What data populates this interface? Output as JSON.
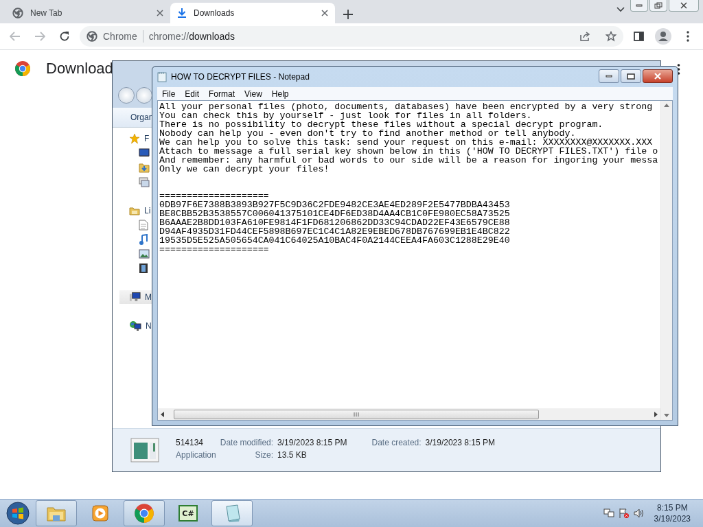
{
  "browser": {
    "tabs": [
      {
        "kind": "newtab",
        "title": "New Tab",
        "selected": false
      },
      {
        "kind": "downloads",
        "title": "Downloads",
        "selected": true
      }
    ],
    "omnibox": {
      "site_label": "Chrome",
      "url_scheme": "chrome://",
      "url_path": "downloads"
    },
    "page_title": "Download"
  },
  "explorer": {
    "toolbar_label": "Organ",
    "nav_groups": [
      {
        "label": "F",
        "kind": "favorites"
      },
      {
        "label": "Li",
        "kind": "libraries"
      },
      {
        "label": "M",
        "kind": "computer",
        "selected": true
      },
      {
        "label": "N",
        "kind": "network",
        "selected": false
      }
    ],
    "details": {
      "name": "514134",
      "type": "Application",
      "fields": [
        {
          "label": "Date modified:",
          "value": "3/19/2023 8:15 PM"
        },
        {
          "label": "Date created:",
          "value": "3/19/2023 8:15 PM"
        },
        {
          "label": "Size:",
          "value": "13.5 KB"
        }
      ]
    }
  },
  "notepad": {
    "title": "HOW TO DECRYPT FILES - Notepad",
    "menu": [
      "File",
      "Edit",
      "Format",
      "View",
      "Help"
    ],
    "message": [
      "All your personal files (photo, documents, databases) have been encrypted by a very strong",
      "You can check this by yourself - just look for files in all folders.",
      "There is no possibility to decrypt these files without a special decrypt program.",
      "Nobody can help you - even don't try to find another method or tell anybody.",
      "We can help you to solve this task: send your request on this e-mail: XXXXXXXX@XXXXXXX.XXX",
      "Attach to message a full serial key shown below in this ('HOW TO DECRYPT FILES.TXT') file o",
      "And remember: any harmful or bad words to our side will be a reason for ingoring your messa",
      "Only we can decrypt your files!"
    ],
    "key_block": [
      "====================",
      "0DB97F6E7388B3893B927F5C9D36C2FDE9482CE3AE4ED289F2E5477BDBA43453",
      "BE8CBB52B3538557C006041375101CE4DF6ED38D4AA4CB1C0FE980EC58A73525",
      "B6AAAE2B8DD103FA610FE9814F1FD681206862DD33C94CDAD22EF43E6579CE88",
      "D94AF4935D31FD44CEF5898B697EC1C4C1A82E9EBED678DB767699EB1E4BC822",
      "19535D5E525A505654CA041C64025A10BAC4F0A2144CEEA4FA603C1288E29E40",
      "===================="
    ]
  },
  "taskbar": {
    "apps": [
      {
        "kind": "folder",
        "running": true,
        "selected": false
      },
      {
        "kind": "media",
        "running": false,
        "selected": false
      },
      {
        "kind": "chrome",
        "running": true,
        "selected": false
      },
      {
        "kind": "csharp",
        "label": "C#",
        "running": false,
        "selected": false
      },
      {
        "kind": "notepad",
        "running": true,
        "selected": true
      }
    ],
    "time": "8:15 PM",
    "date": "3/19/2023"
  }
}
